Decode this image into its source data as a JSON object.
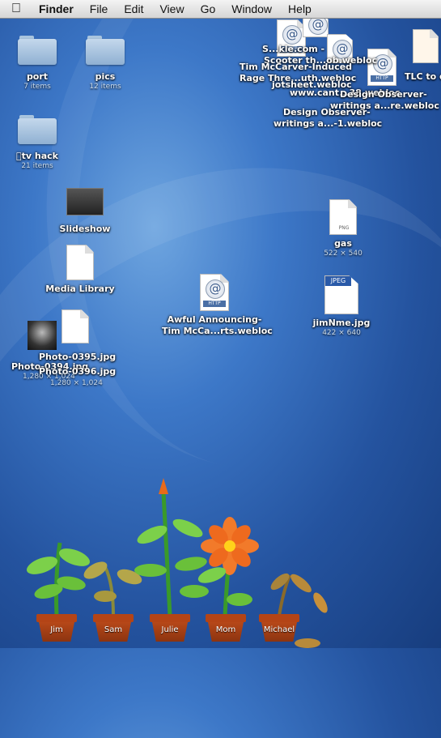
{
  "menubar": {
    "apple": "",
    "items": [
      "Finder",
      "File",
      "Edit",
      "View",
      "Go",
      "Window",
      "Help"
    ]
  },
  "desktop": {
    "folders": [
      {
        "name": "port",
        "sub": "7 items"
      },
      {
        "name": "pics",
        "sub": "12 items"
      },
      {
        "name": "tv hack",
        "sub": "21 items"
      }
    ],
    "apps": [
      {
        "name": "Slideshow"
      },
      {
        "name": "Media Library"
      }
    ],
    "webloc_top": [
      {
        "name": "S...kle.com -"
      },
      {
        "name": "Scooter th...ob.webloc"
      },
      {
        "name": "Tim McCarver-Induced"
      },
      {
        "name": "Rage Thre...uth.webloc"
      },
      {
        "name": "jotsheet.webloc"
      },
      {
        "name": "www.cant...38.webloc"
      },
      {
        "name": "Design Observer-"
      },
      {
        "name": "writings a...re.webloc"
      },
      {
        "name": "Design Observer-"
      },
      {
        "name": "writings a...-1.webloc"
      },
      {
        "name": "TLC to d"
      }
    ],
    "awful": {
      "line1": "Awful Announcing-",
      "line2": "Tim McCa...rts.webloc"
    },
    "gas": {
      "name": "gas",
      "sub": "522 × 540",
      "tag": "PNG"
    },
    "jim": {
      "name": "jimNme.jpg",
      "sub": "422 × 640",
      "tag": "JPEG"
    },
    "photos": [
      {
        "name": "Photo-0395.jpg",
        "sub": "1,280 × 1,024"
      },
      {
        "name": "Photo-0394.jpg",
        "sub": "1,280 × 1,024"
      },
      {
        "name": "Photo-0396.jpg",
        "sub": "1,280 × 1,024"
      }
    ],
    "pots": [
      "Jim",
      "Sam",
      "Julie",
      "Mom",
      "Michael"
    ]
  }
}
